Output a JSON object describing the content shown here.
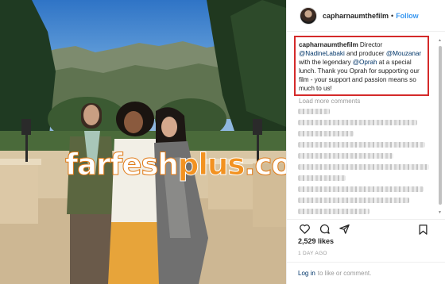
{
  "post": {
    "username": "capharnaumthefilm",
    "follow_separator": "•",
    "follow_label": "Follow",
    "caption_user": "capharnaumthefilm",
    "caption_parts": {
      "p1": " Director ",
      "m1": "@NadineLabaki",
      "p2": " and producer ",
      "m2": "@Mouzanar",
      "p3": " with the legendary ",
      "m3": "@Oprah",
      "p4": " at a special lunch. Thank you Oprah for supporting our film - your support and passion means so much to us!"
    },
    "load_more": "Load more comments",
    "likes": "2,529 likes",
    "date": "1 DAY AGO",
    "login_link": "Log in",
    "login_rest": "to like or comment."
  },
  "watermark": {
    "part1": "farfesh",
    "part2": "plus",
    "part3": ".com"
  },
  "colors": {
    "follow_blue": "#3897f0",
    "highlight_box": "#d42a2a",
    "watermark_orange": "#f29221"
  },
  "icons": [
    "heart-icon",
    "comment-icon",
    "share-icon",
    "bookmark-icon"
  ]
}
